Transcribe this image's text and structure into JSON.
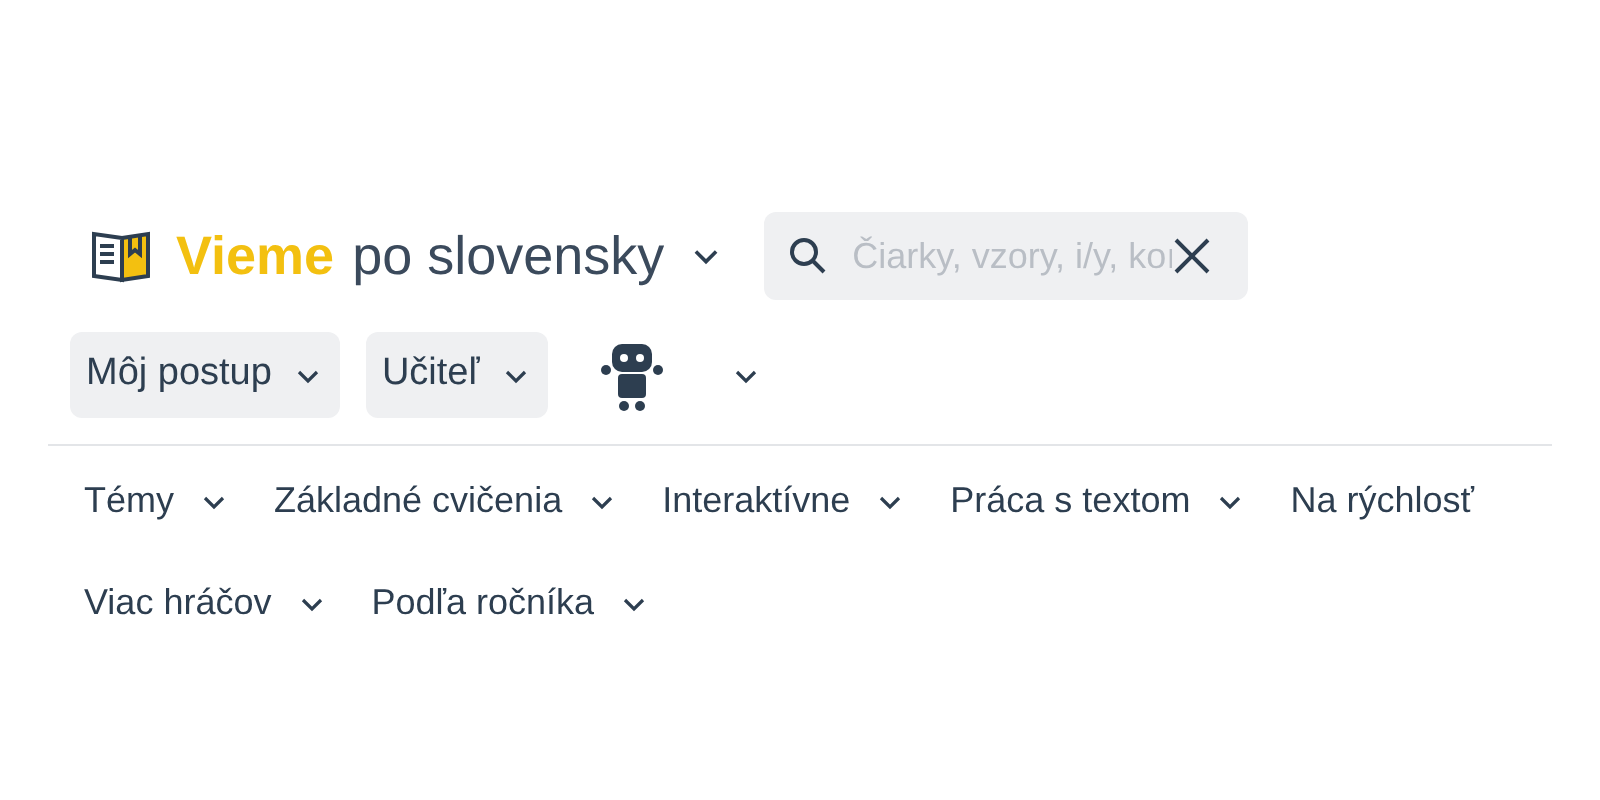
{
  "logo": {
    "brand": "Vieme",
    "subtitle": "po slovensky"
  },
  "search": {
    "placeholder": "Čiarky, vzory, i/y, koı"
  },
  "buttons": [
    {
      "label": "Môj postup"
    },
    {
      "label": "Učiteľ"
    }
  ],
  "nav": [
    {
      "label": "Témy",
      "dropdown": true
    },
    {
      "label": "Základné cvičenia",
      "dropdown": true
    },
    {
      "label": "Interaktívne",
      "dropdown": true
    },
    {
      "label": "Práca s textom",
      "dropdown": true
    },
    {
      "label": "Na rýchlosť",
      "dropdown": false
    },
    {
      "label": "Viac hráčov",
      "dropdown": true
    },
    {
      "label": "Podľa ročníka",
      "dropdown": true
    }
  ]
}
